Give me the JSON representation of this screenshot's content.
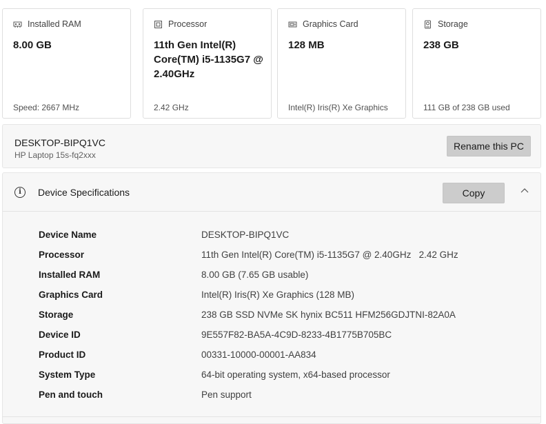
{
  "cards": [
    {
      "icon": "ram-icon",
      "label": "Installed RAM",
      "value": "8.00 GB",
      "sub": "Speed: 2667 MHz"
    },
    {
      "icon": "processor-icon",
      "label": "Processor",
      "value": "11th Gen Intel(R) Core(TM) i5-1135G7 @ 2.40GHz",
      "sub": "2.42 GHz"
    },
    {
      "icon": "graphics-card-icon",
      "label": "Graphics Card",
      "value": "128 MB",
      "sub": "Intel(R) Iris(R) Xe Graphics"
    },
    {
      "icon": "storage-icon",
      "label": "Storage",
      "value": "238 GB",
      "sub": "111 GB of 238 GB used"
    }
  ],
  "pc": {
    "name": "DESKTOP-BIPQ1VC",
    "model": "HP Laptop 15s-fq2xxx",
    "rename_label": "Rename this PC"
  },
  "spec": {
    "title": "Device Specifications",
    "copy_label": "Copy",
    "rows": [
      {
        "label": "Device Name",
        "value": "DESKTOP-BIPQ1VC"
      },
      {
        "label": "Processor",
        "value": "11th Gen Intel(R) Core(TM) i5-1135G7 @ 2.40GHz   2.42 GHz"
      },
      {
        "label": "Installed RAM",
        "value": "8.00 GB (7.65 GB usable)"
      },
      {
        "label": "Graphics Card",
        "value": "Intel(R) Iris(R) Xe Graphics (128 MB)"
      },
      {
        "label": "Storage",
        "value": "238 GB SSD NVMe SK hynix BC511 HFM256GDJTNI-82A0A"
      },
      {
        "label": "Device ID",
        "value": "9E557F82-BA5A-4C9D-8233-4B1775B705BC"
      },
      {
        "label": "Product ID",
        "value": "00331-10000-00001-AA834"
      },
      {
        "label": "System Type",
        "value": "64-bit operating system, x64-based processor"
      },
      {
        "label": "Pen and touch",
        "value": "Pen support"
      }
    ]
  },
  "colors": {
    "button_bg": "#cccccc",
    "panel_bg": "#f7f7f7",
    "border": "#dedede"
  }
}
